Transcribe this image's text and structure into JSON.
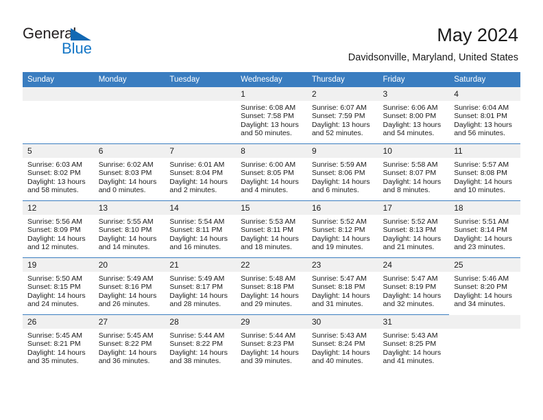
{
  "brand": {
    "name_part1": "General",
    "name_part2": "Blue",
    "triangle_icon": "triangle-icon",
    "accent_color": "#1476c6"
  },
  "header": {
    "title": "May 2024",
    "location": "Davidsonville, Maryland, United States"
  },
  "theme": {
    "header_row_bg": "#3a7dc0",
    "day_number_bg": "#f0f0f0",
    "row_divider": "#3a7dc0",
    "text": "#1a1a1a"
  },
  "weekdays": [
    "Sunday",
    "Monday",
    "Tuesday",
    "Wednesday",
    "Thursday",
    "Friday",
    "Saturday"
  ],
  "labels": {
    "sunrise": "Sunrise:",
    "sunset": "Sunset:",
    "daylight": "Daylight:"
  },
  "weeks": [
    [
      {
        "day": "",
        "empty": true
      },
      {
        "day": "",
        "empty": true
      },
      {
        "day": "",
        "empty": true
      },
      {
        "day": "1",
        "sunrise": "Sunrise: 6:08 AM",
        "sunset": "Sunset: 7:58 PM",
        "daylight": "Daylight: 13 hours and 50 minutes."
      },
      {
        "day": "2",
        "sunrise": "Sunrise: 6:07 AM",
        "sunset": "Sunset: 7:59 PM",
        "daylight": "Daylight: 13 hours and 52 minutes."
      },
      {
        "day": "3",
        "sunrise": "Sunrise: 6:06 AM",
        "sunset": "Sunset: 8:00 PM",
        "daylight": "Daylight: 13 hours and 54 minutes."
      },
      {
        "day": "4",
        "sunrise": "Sunrise: 6:04 AM",
        "sunset": "Sunset: 8:01 PM",
        "daylight": "Daylight: 13 hours and 56 minutes."
      }
    ],
    [
      {
        "day": "5",
        "sunrise": "Sunrise: 6:03 AM",
        "sunset": "Sunset: 8:02 PM",
        "daylight": "Daylight: 13 hours and 58 minutes."
      },
      {
        "day": "6",
        "sunrise": "Sunrise: 6:02 AM",
        "sunset": "Sunset: 8:03 PM",
        "daylight": "Daylight: 14 hours and 0 minutes."
      },
      {
        "day": "7",
        "sunrise": "Sunrise: 6:01 AM",
        "sunset": "Sunset: 8:04 PM",
        "daylight": "Daylight: 14 hours and 2 minutes."
      },
      {
        "day": "8",
        "sunrise": "Sunrise: 6:00 AM",
        "sunset": "Sunset: 8:05 PM",
        "daylight": "Daylight: 14 hours and 4 minutes."
      },
      {
        "day": "9",
        "sunrise": "Sunrise: 5:59 AM",
        "sunset": "Sunset: 8:06 PM",
        "daylight": "Daylight: 14 hours and 6 minutes."
      },
      {
        "day": "10",
        "sunrise": "Sunrise: 5:58 AM",
        "sunset": "Sunset: 8:07 PM",
        "daylight": "Daylight: 14 hours and 8 minutes."
      },
      {
        "day": "11",
        "sunrise": "Sunrise: 5:57 AM",
        "sunset": "Sunset: 8:08 PM",
        "daylight": "Daylight: 14 hours and 10 minutes."
      }
    ],
    [
      {
        "day": "12",
        "sunrise": "Sunrise: 5:56 AM",
        "sunset": "Sunset: 8:09 PM",
        "daylight": "Daylight: 14 hours and 12 minutes."
      },
      {
        "day": "13",
        "sunrise": "Sunrise: 5:55 AM",
        "sunset": "Sunset: 8:10 PM",
        "daylight": "Daylight: 14 hours and 14 minutes."
      },
      {
        "day": "14",
        "sunrise": "Sunrise: 5:54 AM",
        "sunset": "Sunset: 8:11 PM",
        "daylight": "Daylight: 14 hours and 16 minutes."
      },
      {
        "day": "15",
        "sunrise": "Sunrise: 5:53 AM",
        "sunset": "Sunset: 8:11 PM",
        "daylight": "Daylight: 14 hours and 18 minutes."
      },
      {
        "day": "16",
        "sunrise": "Sunrise: 5:52 AM",
        "sunset": "Sunset: 8:12 PM",
        "daylight": "Daylight: 14 hours and 19 minutes."
      },
      {
        "day": "17",
        "sunrise": "Sunrise: 5:52 AM",
        "sunset": "Sunset: 8:13 PM",
        "daylight": "Daylight: 14 hours and 21 minutes."
      },
      {
        "day": "18",
        "sunrise": "Sunrise: 5:51 AM",
        "sunset": "Sunset: 8:14 PM",
        "daylight": "Daylight: 14 hours and 23 minutes."
      }
    ],
    [
      {
        "day": "19",
        "sunrise": "Sunrise: 5:50 AM",
        "sunset": "Sunset: 8:15 PM",
        "daylight": "Daylight: 14 hours and 24 minutes."
      },
      {
        "day": "20",
        "sunrise": "Sunrise: 5:49 AM",
        "sunset": "Sunset: 8:16 PM",
        "daylight": "Daylight: 14 hours and 26 minutes."
      },
      {
        "day": "21",
        "sunrise": "Sunrise: 5:49 AM",
        "sunset": "Sunset: 8:17 PM",
        "daylight": "Daylight: 14 hours and 28 minutes."
      },
      {
        "day": "22",
        "sunrise": "Sunrise: 5:48 AM",
        "sunset": "Sunset: 8:18 PM",
        "daylight": "Daylight: 14 hours and 29 minutes."
      },
      {
        "day": "23",
        "sunrise": "Sunrise: 5:47 AM",
        "sunset": "Sunset: 8:18 PM",
        "daylight": "Daylight: 14 hours and 31 minutes."
      },
      {
        "day": "24",
        "sunrise": "Sunrise: 5:47 AM",
        "sunset": "Sunset: 8:19 PM",
        "daylight": "Daylight: 14 hours and 32 minutes."
      },
      {
        "day": "25",
        "sunrise": "Sunrise: 5:46 AM",
        "sunset": "Sunset: 8:20 PM",
        "daylight": "Daylight: 14 hours and 34 minutes."
      }
    ],
    [
      {
        "day": "26",
        "sunrise": "Sunrise: 5:45 AM",
        "sunset": "Sunset: 8:21 PM",
        "daylight": "Daylight: 14 hours and 35 minutes."
      },
      {
        "day": "27",
        "sunrise": "Sunrise: 5:45 AM",
        "sunset": "Sunset: 8:22 PM",
        "daylight": "Daylight: 14 hours and 36 minutes."
      },
      {
        "day": "28",
        "sunrise": "Sunrise: 5:44 AM",
        "sunset": "Sunset: 8:22 PM",
        "daylight": "Daylight: 14 hours and 38 minutes."
      },
      {
        "day": "29",
        "sunrise": "Sunrise: 5:44 AM",
        "sunset": "Sunset: 8:23 PM",
        "daylight": "Daylight: 14 hours and 39 minutes."
      },
      {
        "day": "30",
        "sunrise": "Sunrise: 5:43 AM",
        "sunset": "Sunset: 8:24 PM",
        "daylight": "Daylight: 14 hours and 40 minutes."
      },
      {
        "day": "31",
        "sunrise": "Sunrise: 5:43 AM",
        "sunset": "Sunset: 8:25 PM",
        "daylight": "Daylight: 14 hours and 41 minutes."
      },
      {
        "day": "",
        "empty": true
      }
    ]
  ]
}
